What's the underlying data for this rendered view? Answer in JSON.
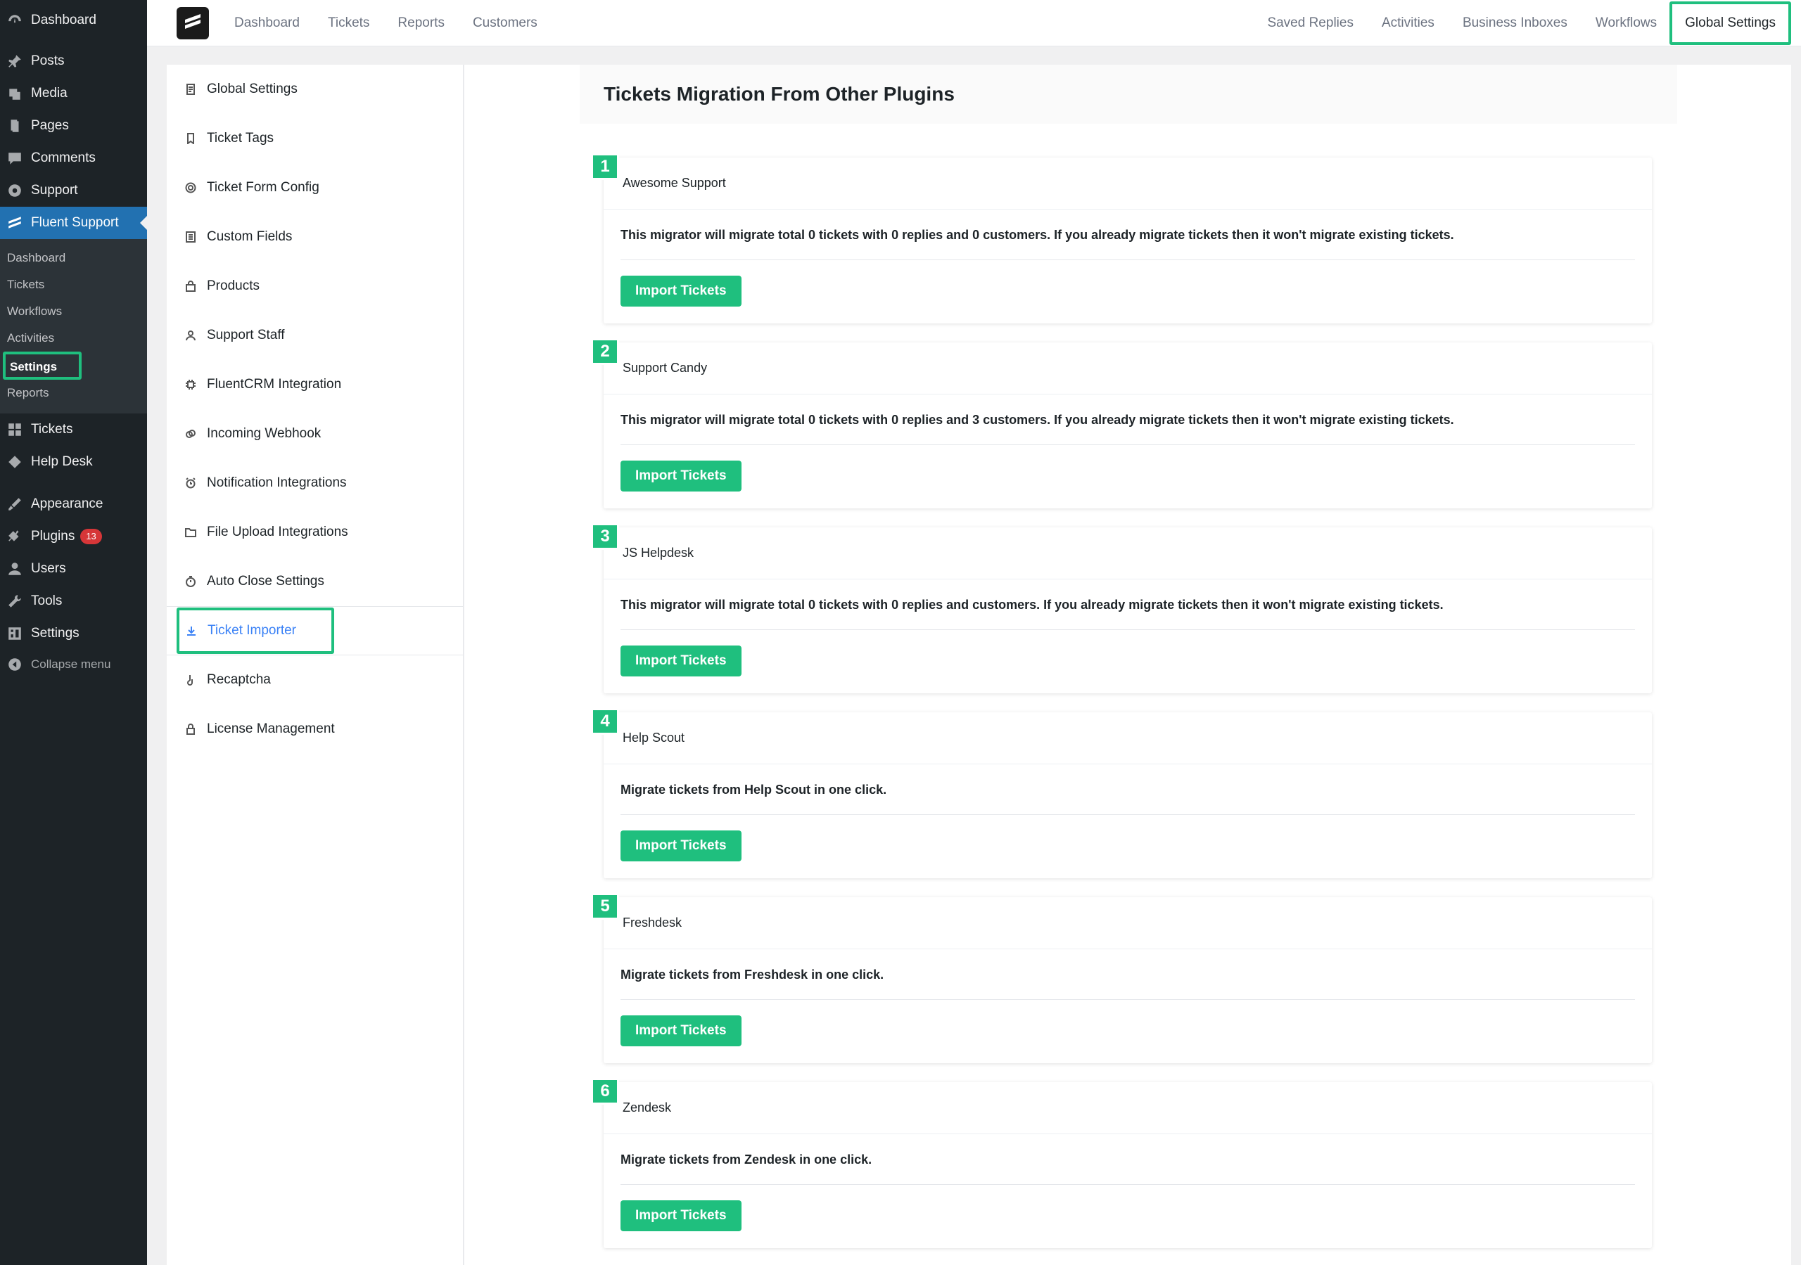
{
  "wp_menu": {
    "top": [
      {
        "label": "Dashboard",
        "icon": "dashboard-icon"
      }
    ],
    "main": [
      {
        "label": "Posts",
        "icon": "pin-icon"
      },
      {
        "label": "Media",
        "icon": "media-icon"
      },
      {
        "label": "Pages",
        "icon": "pages-icon"
      },
      {
        "label": "Comments",
        "icon": "comment-icon"
      },
      {
        "label": "Support",
        "icon": "support-icon"
      },
      {
        "label": "Fluent Support",
        "icon": "fluent-icon"
      }
    ],
    "sub": [
      "Dashboard",
      "Tickets",
      "Workflows",
      "Activities",
      "Settings",
      "Reports"
    ],
    "lower": [
      {
        "label": "Tickets",
        "icon": "grid-icon"
      },
      {
        "label": "Help Desk",
        "icon": "ticket-icon"
      }
    ],
    "admin": [
      {
        "label": "Appearance",
        "icon": "brush-icon"
      },
      {
        "label": "Plugins",
        "icon": "plugin-icon",
        "badge": "13"
      },
      {
        "label": "Users",
        "icon": "user-icon"
      },
      {
        "label": "Tools",
        "icon": "wrench-icon"
      },
      {
        "label": "Settings",
        "icon": "settings-icon"
      }
    ],
    "collapse": "Collapse menu"
  },
  "topnav": {
    "left": [
      "Dashboard",
      "Tickets",
      "Reports",
      "Customers"
    ],
    "right": [
      "Saved Replies",
      "Activities",
      "Business Inboxes",
      "Workflows"
    ],
    "active": "Global Settings"
  },
  "settings_menu": [
    {
      "label": "Global Settings",
      "icon": "document-icon"
    },
    {
      "label": "Ticket Tags",
      "icon": "bookmark-icon"
    },
    {
      "label": "Ticket Form Config",
      "icon": "gear-icon"
    },
    {
      "label": "Custom Fields",
      "icon": "list-icon"
    },
    {
      "label": "Products",
      "icon": "bag-icon"
    },
    {
      "label": "Support Staff",
      "icon": "person-icon"
    },
    {
      "label": "FluentCRM Integration",
      "icon": "chip-icon"
    },
    {
      "label": "Incoming Webhook",
      "icon": "link-icon"
    },
    {
      "label": "Notification Integrations",
      "icon": "alarm-icon"
    },
    {
      "label": "File Upload Integrations",
      "icon": "folder-icon"
    },
    {
      "label": "Auto Close Settings",
      "icon": "timer-icon"
    },
    {
      "label": "Ticket Importer",
      "icon": "download-icon"
    },
    {
      "label": "Recaptcha",
      "icon": "hand-icon"
    },
    {
      "label": "License Management",
      "icon": "lock-icon"
    }
  ],
  "page": {
    "title": "Tickets Migration From Other Plugins",
    "button_label": "Import Tickets"
  },
  "migrators": [
    {
      "num": "1",
      "name": "Awesome Support",
      "desc": "This migrator will migrate total 0 tickets with 0 replies and 0 customers. If you already migrate tickets then it won't migrate existing tickets."
    },
    {
      "num": "2",
      "name": "Support Candy",
      "desc": "This migrator will migrate total 0 tickets with 0 replies and 3 customers. If you already migrate tickets then it won't migrate existing tickets."
    },
    {
      "num": "3",
      "name": "JS Helpdesk",
      "desc": "This migrator will migrate total 0 tickets with 0 replies and customers. If you already migrate tickets then it won't migrate existing tickets."
    },
    {
      "num": "4",
      "name": "Help Scout",
      "desc": "Migrate tickets from Help Scout in one click."
    },
    {
      "num": "5",
      "name": "Freshdesk",
      "desc": "Migrate tickets from Freshdesk in one click."
    },
    {
      "num": "6",
      "name": "Zendesk",
      "desc": "Migrate tickets from Zendesk in one click."
    }
  ],
  "colors": {
    "accent": "#1fbf7e",
    "wp_sidebar": "#1d2327",
    "wp_active": "#2271b1",
    "link_active": "#3b82f6"
  }
}
